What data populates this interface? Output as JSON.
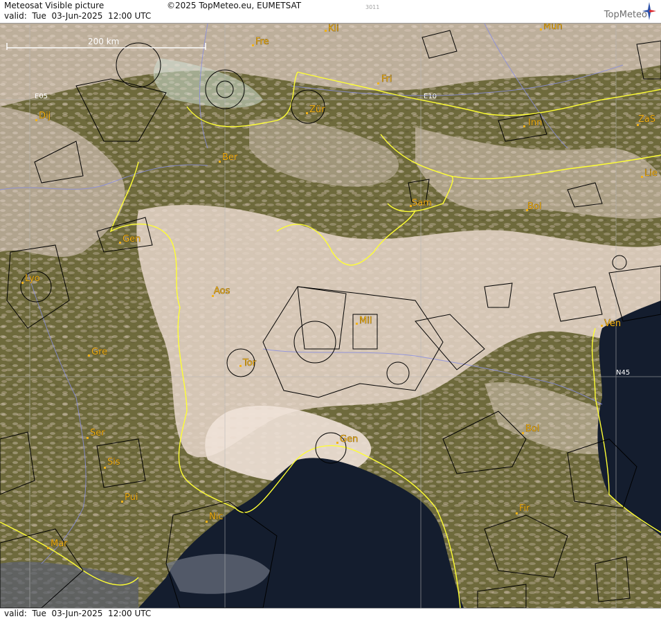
{
  "header": {
    "product_title": "Meteosat Visible picture",
    "copyright": "©2025 TopMeteo.eu, EUMETSAT",
    "valid_line": "valid:  Tue  03-Jun-2025  12:00 UTC",
    "image_code": "3011",
    "brand": "TopMeteo"
  },
  "footer": {
    "valid_line": "valid:  Tue  03-Jun-2025  12:00 UTC"
  },
  "map": {
    "scale_label": "200 km",
    "grid_labels": [
      "E05",
      "E10",
      "N45"
    ],
    "cities": [
      {
        "name": "Kli"
      },
      {
        "name": "Mun"
      },
      {
        "name": "Fre"
      },
      {
        "name": "Fri"
      },
      {
        "name": "Dij"
      },
      {
        "name": "Zür"
      },
      {
        "name": "Inn"
      },
      {
        "name": "ZaS"
      },
      {
        "name": "Ber"
      },
      {
        "name": "Lie"
      },
      {
        "name": "Sam"
      },
      {
        "name": "Bol"
      },
      {
        "name": "Gen"
      },
      {
        "name": "Lyo"
      },
      {
        "name": "Aos"
      },
      {
        "name": "Mil"
      },
      {
        "name": "Ven"
      },
      {
        "name": "Gre"
      },
      {
        "name": "Tor"
      },
      {
        "name": "Gen"
      },
      {
        "name": "Bol"
      },
      {
        "name": "Ser"
      },
      {
        "name": "Sis"
      },
      {
        "name": "Pui"
      },
      {
        "name": "Nic"
      },
      {
        "name": "Fir"
      },
      {
        "name": "Mar"
      }
    ],
    "colors": {
      "land": "#6e6a3c",
      "cloud": "#e6d3c6",
      "sea": "#141d2e",
      "border": "#ffff33",
      "river": "#8a8ee0",
      "airspace": "#000000",
      "label": "#f2b21a"
    }
  }
}
